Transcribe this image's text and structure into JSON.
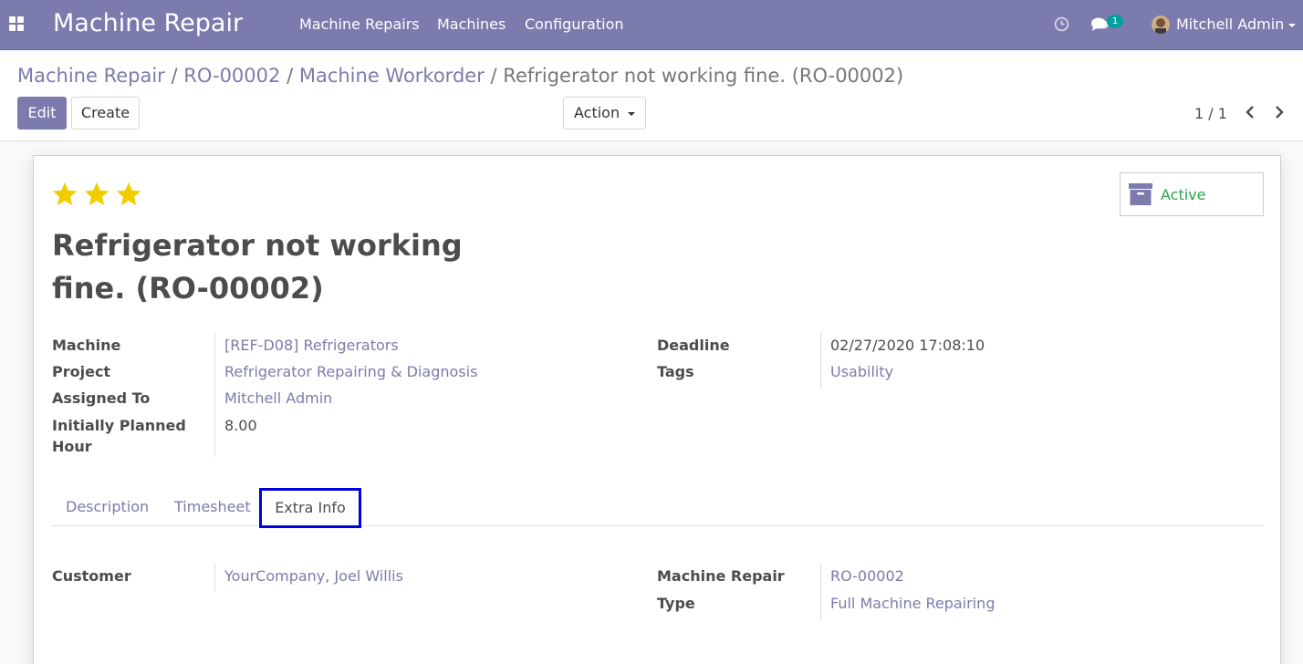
{
  "navbar": {
    "brand": "Machine Repair",
    "menu": [
      "Machine Repairs",
      "Machines",
      "Configuration"
    ],
    "chat_count": "1",
    "user_name": "Mitchell Admin"
  },
  "breadcrumb": {
    "items": [
      "Machine Repair",
      "RO-00002",
      "Machine Workorder"
    ],
    "current": "Refrigerator not working fine. (RO-00002)",
    "separator": "/"
  },
  "toolbar": {
    "edit_label": "Edit",
    "create_label": "Create",
    "action_label": "Action"
  },
  "pager": {
    "value": "1 / 1"
  },
  "record": {
    "priority_stars": 3,
    "active_label": "Active",
    "title_line1": "Refrigerator not working",
    "title_line2": "fine. (RO-00002)"
  },
  "fields_left": {
    "machine_label": "Machine",
    "machine_value": "[REF-D08] Refrigerators",
    "project_label": "Project",
    "project_value": "Refrigerator Repairing & Diagnosis",
    "assigned_label": "Assigned To",
    "assigned_value": "Mitchell Admin",
    "planned_label_line1": "Initially Planned",
    "planned_label_line2": "Hour",
    "planned_value": "8.00"
  },
  "fields_right": {
    "deadline_label": "Deadline",
    "deadline_value": "02/27/2020 17:08:10",
    "tags_label": "Tags",
    "tags_value": "Usability"
  },
  "tabs": {
    "items": [
      "Description",
      "Timesheet",
      "Extra Info"
    ],
    "active": "Extra Info"
  },
  "extra_info": {
    "customer_label": "Customer",
    "customer_value": "YourCompany, Joel Willis",
    "repair_label": "Machine Repair",
    "repair_value": "RO-00002",
    "type_label": "Type",
    "type_value": "Full Machine Repairing"
  },
  "colors": {
    "brand": "#7c7bad",
    "star": "#f3cc00",
    "active_green": "#28a745",
    "tab_highlight": "#0000dd"
  }
}
